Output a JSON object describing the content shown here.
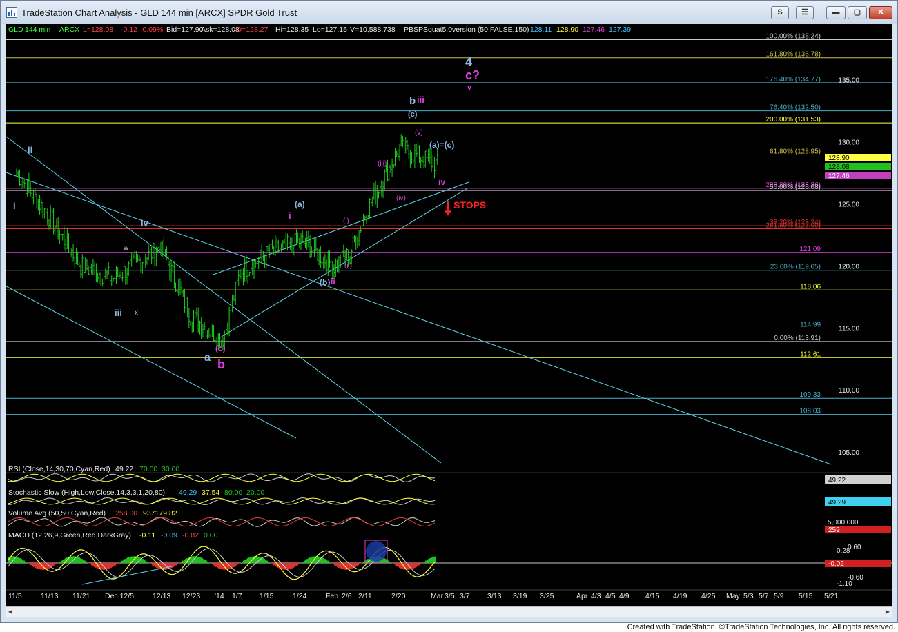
{
  "window": {
    "title": "TradeStation Chart Analysis - GLD 144 min [ARCX] SPDR Gold Trust",
    "btn_s": "S",
    "btn_tools": "☰",
    "btn_min": "▬",
    "btn_max": "▢",
    "btn_close": "✕"
  },
  "quote": {
    "symbol": "GLD",
    "interval": "144 min",
    "exchange": "ARCX",
    "last": "L=128.08",
    "chg": "-0.12",
    "chgpct": "-0.09%",
    "bid": "Bid=127.90",
    "ask": "Ask=128.08",
    "open": "O=128.27",
    "high": "Hi=128.35",
    "low": "Lo=127.15",
    "volume": "V=10,588,738",
    "indicator": "PBSPSquat5.0version (50,FALSE,150)",
    "v1": "128.11",
    "v2": "128.90",
    "v3": "127.46",
    "v4": "127.39"
  },
  "price_axis": [
    "135.00",
    "130.00",
    "125.00",
    "120.00",
    "115.00",
    "110.00",
    "105.00"
  ],
  "right_tags": {
    "t1": "128.90",
    "t2": "128.08",
    "t3": "127.46"
  },
  "hlines": [
    {
      "label": "100.00% (138.24)",
      "price": 138.24,
      "color": "#c8c8c8"
    },
    {
      "label": "161.80% (136.78)",
      "price": 136.78,
      "color": "#c8c050"
    },
    {
      "label": "176.40% (134.77)",
      "price": 134.77,
      "color": "#4ab0c8"
    },
    {
      "label": "76.40% (132.50)",
      "price": 132.5,
      "color": "#4ab0c8"
    },
    {
      "label": "200.00% (131.53)",
      "price": 131.53,
      "color": "#ffff40"
    },
    {
      "label": "61.80% (128.95)",
      "price": 128.95,
      "color": "#c8c050"
    },
    {
      "label": "238.20% (126.26)",
      "price": 126.26,
      "color": "#e040e0"
    },
    {
      "label": "50.00% (126.08)",
      "price": 126.08,
      "color": "#c8c8c8"
    },
    {
      "label": "38.20% (123.24)",
      "price": 123.24,
      "color": "#e03030"
    },
    {
      "label": "261.80% (123.00)",
      "price": 123.0,
      "color": "#e03030"
    },
    {
      "label": "121.09",
      "price": 121.09,
      "color": "#e040e0"
    },
    {
      "label": "23.60% (119.65)",
      "price": 119.65,
      "color": "#4ab0c8"
    },
    {
      "label": "118.06",
      "price": 118.06,
      "color": "#ffff40"
    },
    {
      "label": "114.99",
      "price": 114.99,
      "color": "#4ab0c8"
    },
    {
      "label": "0.00% (113.91)",
      "price": 113.91,
      "color": "#c8c8c8"
    },
    {
      "label": "112.61",
      "price": 112.61,
      "color": "#ffff40"
    },
    {
      "label": "109.33",
      "price": 109.33,
      "color": "#4ab0c8"
    },
    {
      "label": "108.03",
      "price": 108.03,
      "color": "#4ab0c8"
    }
  ],
  "waves": {
    "w4": "4",
    "wc": "c?",
    "wv": "v",
    "wb": "b",
    "wiii": "iii",
    "wc2": "(c)",
    "wv2": "(v)",
    "wac": "(a)=(c)",
    "wiii2": "(iii)",
    "wiv2": "(iv)",
    "wiv": "iv",
    "stops": "STOPS",
    "wii": "ii",
    "wi": "i",
    "wiv3": "iv",
    "ww": "w",
    "wiii3": "iii",
    "wx": "x",
    "wa": "(a)",
    "wi2": "i",
    "wi3": "(i)",
    "wb2": "(b)",
    "wii2": "ii",
    "wii3": "(ii)",
    "wa2": "a",
    "wc3": "(c)",
    "wb3": "b"
  },
  "indicators": {
    "rsi": {
      "label": "RSI (Close,14,30,70,Cyan,Red)",
      "v": "49.22",
      "hi": "70.00",
      "lo": "30.00",
      "tag": "49.22"
    },
    "stoch": {
      "label": "Stochastic Slow (High,Low,Close,14,3,3,1,20,80)",
      "v1": "49.29",
      "v2": "37.54",
      "hi": "80.00",
      "lo": "20.00",
      "tag": "49.29"
    },
    "vol": {
      "label": "Volume Avg (50,50,Cyan,Red)",
      "v1": "258.00",
      "v2": "937179.82",
      "tag1": "5,000,000",
      "tag2": "259"
    },
    "macd": {
      "label": "MACD (12,26,9,Green,Red,DarkGray)",
      "v1": "-0.11",
      "v2": "-0.09",
      "v3": "-0.02",
      "v4": "0.00",
      "ax1": "0.60",
      "ax2": "0.28",
      "ax3": "-0.02",
      "ax4": "-0.60",
      "ax5": "-1.10"
    }
  },
  "dates": [
    "11/5",
    "11/13",
    "11/21",
    "Dec 12/5",
    "12/13",
    "12/23",
    "'14",
    "1/7",
    "1/15",
    "1/24",
    "Feb",
    "2/6",
    "2/11",
    "2/20",
    "Mar",
    "3/5",
    "3/7",
    "3/13",
    "3/19",
    "3/25",
    "Apr",
    "4/3",
    "4/5",
    "4/9",
    "4/15",
    "4/19",
    "4/25",
    "May",
    "5/3",
    "5/7",
    "5/9",
    "5/15",
    "5/21"
  ],
  "footer": "Created with TradeStation. ©TradeStation Technologies, Inc. All rights reserved.",
  "chart_data": {
    "type": "candlestick",
    "symbol": "GLD",
    "interval": "144 min",
    "ylim": [
      102.5,
      139.5
    ],
    "close_path_x": [
      "11/5",
      "11/13",
      "11/21",
      "Dec 12/5",
      "12/13",
      "12/23",
      "'14",
      "1/7",
      "1/15",
      "1/24",
      "Feb",
      "2/6",
      "2/11",
      "2/20",
      "Mar"
    ],
    "close_path_y": [
      127.5,
      124,
      120,
      119,
      121.5,
      116,
      114,
      119.5,
      121,
      122,
      120,
      121,
      124.5,
      129.5,
      128.1
    ],
    "colors": {
      "up": "#20d020",
      "down": "#20d020",
      "trend": "#5fd3e8",
      "fib_cyan": "#4ab0c8",
      "fib_yellow": "#ffff40",
      "fib_magenta": "#e040e0",
      "fib_red": "#e03030"
    }
  }
}
